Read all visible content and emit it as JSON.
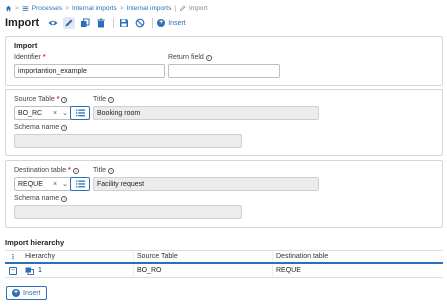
{
  "breadcrumb": {
    "items": [
      "Processes",
      "Internal imports",
      "Internal imports"
    ],
    "current": "Import",
    "separator": ">"
  },
  "header": {
    "title": "Import",
    "insert_label": "Insert"
  },
  "import_card": {
    "title": "Import",
    "identifier_label": "Identifier",
    "identifier_value": "importantion_example",
    "return_field_label": "Return field",
    "return_field_value": ""
  },
  "source_card": {
    "table_label": "Source Table",
    "table_value": "BO_RC",
    "title_label": "Title",
    "title_value": "Booking room",
    "schema_label": "Schema name",
    "schema_value": ""
  },
  "destination_card": {
    "table_label": "Destination table",
    "table_value": "REQUE",
    "title_label": "Title",
    "title_value": "Facility request",
    "schema_label": "Schema name",
    "schema_value": ""
  },
  "hierarchy": {
    "title": "Import hierarchy",
    "columns": [
      "Hierarchy",
      "Source Table",
      "Destination table"
    ],
    "rows": [
      {
        "hierarchy": "1",
        "source": "BO_RO",
        "destination": "REQUE"
      }
    ],
    "insert_label": "Insert"
  },
  "glyphs": {
    "clear": "×",
    "dropdown": "⌄",
    "info": "i",
    "minus": "−",
    "plus": "+",
    "menu": "⋮"
  },
  "colors": {
    "accent": "#2a6fb8",
    "required": "#d9342b",
    "readonly_bg": "#ececec"
  }
}
